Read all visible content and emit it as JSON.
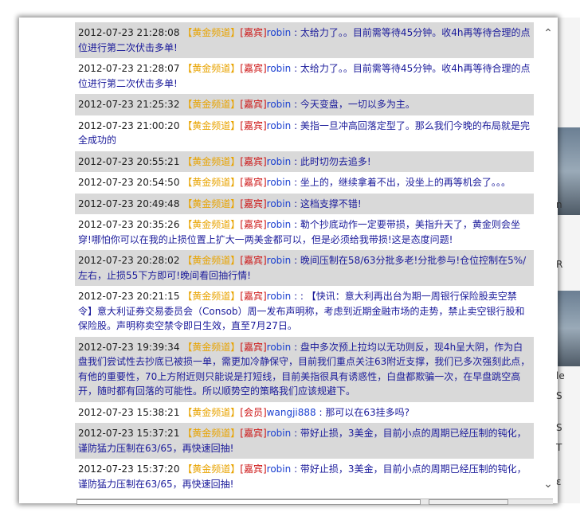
{
  "channel_tag": "【黄金频道】",
  "messages": [
    {
      "ts": "2012-07-23 21:28:08",
      "role": "[嘉宾]",
      "user": "robin",
      "text": ": 太给力了。。目前需等待45分钟。收4h再等待合理的点位进行第二次伏击多单!",
      "alt": true
    },
    {
      "ts": "2012-07-23 21:28:07",
      "role": "[嘉宾]",
      "user": "robin",
      "text": ": 太给力了。。目前需等待45分钟。收4h再等待合理的点位进行第二次伏击多单!",
      "alt": false
    },
    {
      "ts": "2012-07-23 21:25:32",
      "role": "[嘉宾]",
      "user": "robin",
      "text": ": 今天变盘，一切以多为主。",
      "alt": true
    },
    {
      "ts": "2012-07-23 21:00:20",
      "role": "[嘉宾]",
      "user": "robin",
      "text": ": 美指一旦冲高回落定型了。那么我们今晚的布局就是完全成功的",
      "alt": false
    },
    {
      "ts": "2012-07-23 20:55:21",
      "role": "[嘉宾]",
      "user": "robin",
      "text": ": 此时切勿去追多!",
      "alt": true
    },
    {
      "ts": "2012-07-23 20:54:50",
      "role": "[嘉宾]",
      "user": "robin",
      "text": ": 坐上的，继续拿着不出，没坐上的再等机会了。。。",
      "alt": false
    },
    {
      "ts": "2012-07-23 20:49:48",
      "role": "[嘉宾]",
      "user": "robin",
      "text": ": 这档支撑不错!",
      "alt": true
    },
    {
      "ts": "2012-07-23 20:35:26",
      "role": "[嘉宾]",
      "user": "robin",
      "text": ": 勒个抄底动作一定要带损，美指升天了，黄金则会坐穿!哪怕你可以在我的止损位置上扩大一两美金都可以，但是必须给我带损!这是态度问题!",
      "alt": false
    },
    {
      "ts": "2012-07-23 20:28:02",
      "role": "[嘉宾]",
      "user": "robin",
      "text": ": 晚间压制在58/63分批多老!分批参与!仓位控制在5%/左右，止损55下方即可!晚间看回抽行情!",
      "alt": true
    },
    {
      "ts": "2012-07-23 20:21:15",
      "role": "[嘉宾]",
      "user": "robin",
      "text": ": : 【快讯：意大利再出台为期一周银行保险股卖空禁令】意大利证券交易委员会（Consob）周一发布声明称，考虑到近期金融市场的走势，禁止卖空银行股和保险股。声明称卖空禁令即日生效，直至7月27日。",
      "alt": false
    },
    {
      "ts": "2012-07-23 19:39:34",
      "role": "[嘉宾]",
      "user": "robin",
      "text": ": 盘中多次预上拉均以无功则反，现4h呈大阴，作为白盘我们尝试性去抄底已被损一单，需更加冷静保守，目前我们重点关注63附近支撑，我们已多次强刻此点，有他的重要性，70上方附近则只能说是打短线，目前美指很具有诱惑性，白盘都欺骗一次，在早盘跳空高开，随时都有回落的可能性。所以顺势空的策略我们应该规避下。",
      "alt": true
    },
    {
      "ts": "2012-07-23 15:38:21",
      "role": "[会员]",
      "user": "wangji888",
      "text": ": 那可以在63挂多吗?",
      "alt": false
    },
    {
      "ts": "2012-07-23 15:37:21",
      "role": "[嘉宾]",
      "user": "robin",
      "text": ": 带好止损，3美金，目前小点的周期已经压制的钝化，谨防猛力压制在63/65，再快速回抽!",
      "alt": true
    },
    {
      "ts": "2012-07-23 15:37:20",
      "role": "[嘉宾]",
      "user": "robin",
      "text": ": 带好止损，3美金，目前小点的周期已经压制的钝化，谨防猛力压制在63/65，再快速回抽!",
      "alt": false
    }
  ],
  "right_chars": [
    "n",
    "R",
    "le",
    "S",
    "S",
    "T",
    "ε"
  ],
  "scroll": {
    "up": "⌃",
    "down": "⌄"
  }
}
